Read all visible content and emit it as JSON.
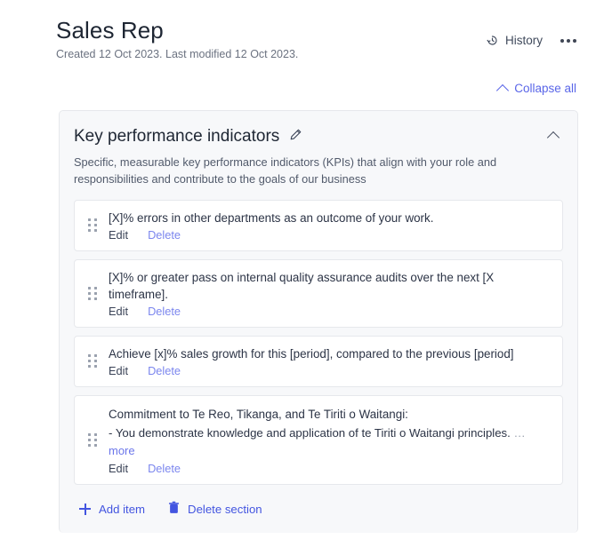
{
  "header": {
    "title": "Sales Rep",
    "meta": "Created 12 Oct 2023. Last modified 12 Oct 2023.",
    "history_label": "History",
    "history_icon": "history-clock-icon",
    "more_icon": "ellipsis-icon"
  },
  "toolbar": {
    "collapse_all_label": "Collapse all",
    "collapse_all_icon": "chevron-up-icon"
  },
  "section": {
    "title": "Key performance indicators",
    "edit_icon": "pencil-icon",
    "toggle_icon": "chevron-up-icon",
    "description": "Specific, measurable key performance indicators (KPIs) that align with your role and responsibilities and contribute to the goals of our business",
    "items": [
      {
        "text": "[X]% errors in other departments as an outcome of your work.",
        "edit_label": "Edit",
        "delete_label": "Delete"
      },
      {
        "text": "[X]% or greater pass on internal quality assurance audits over the next [X timeframe].",
        "edit_label": "Edit",
        "delete_label": "Delete"
      },
      {
        "text": "Achieve [x]% sales growth for this [period], compared to the previous [period]",
        "edit_label": "Edit",
        "delete_label": "Delete"
      },
      {
        "title_line": "Commitment to Te Reo, Tikanga, and Te Tiriti o Waitangi:",
        "sub_line": "- You demonstrate knowledge and application of te Tiriti o Waitangi principles.",
        "truncation": "…",
        "more_label": "more",
        "edit_label": "Edit",
        "delete_label": "Delete"
      }
    ],
    "footer": {
      "add_item_label": "Add item",
      "add_item_icon": "plus-icon",
      "delete_section_label": "Delete section",
      "delete_section_icon": "trash-icon"
    }
  },
  "colors": {
    "link_blue": "#5a66e8",
    "action_blue": "#4355e0",
    "delete_link": "#7b86ee",
    "text_dark": "#1e2633",
    "text_muted": "#6b7280",
    "card_bg": "#f7f8fa",
    "border": "#e6e8ec"
  }
}
